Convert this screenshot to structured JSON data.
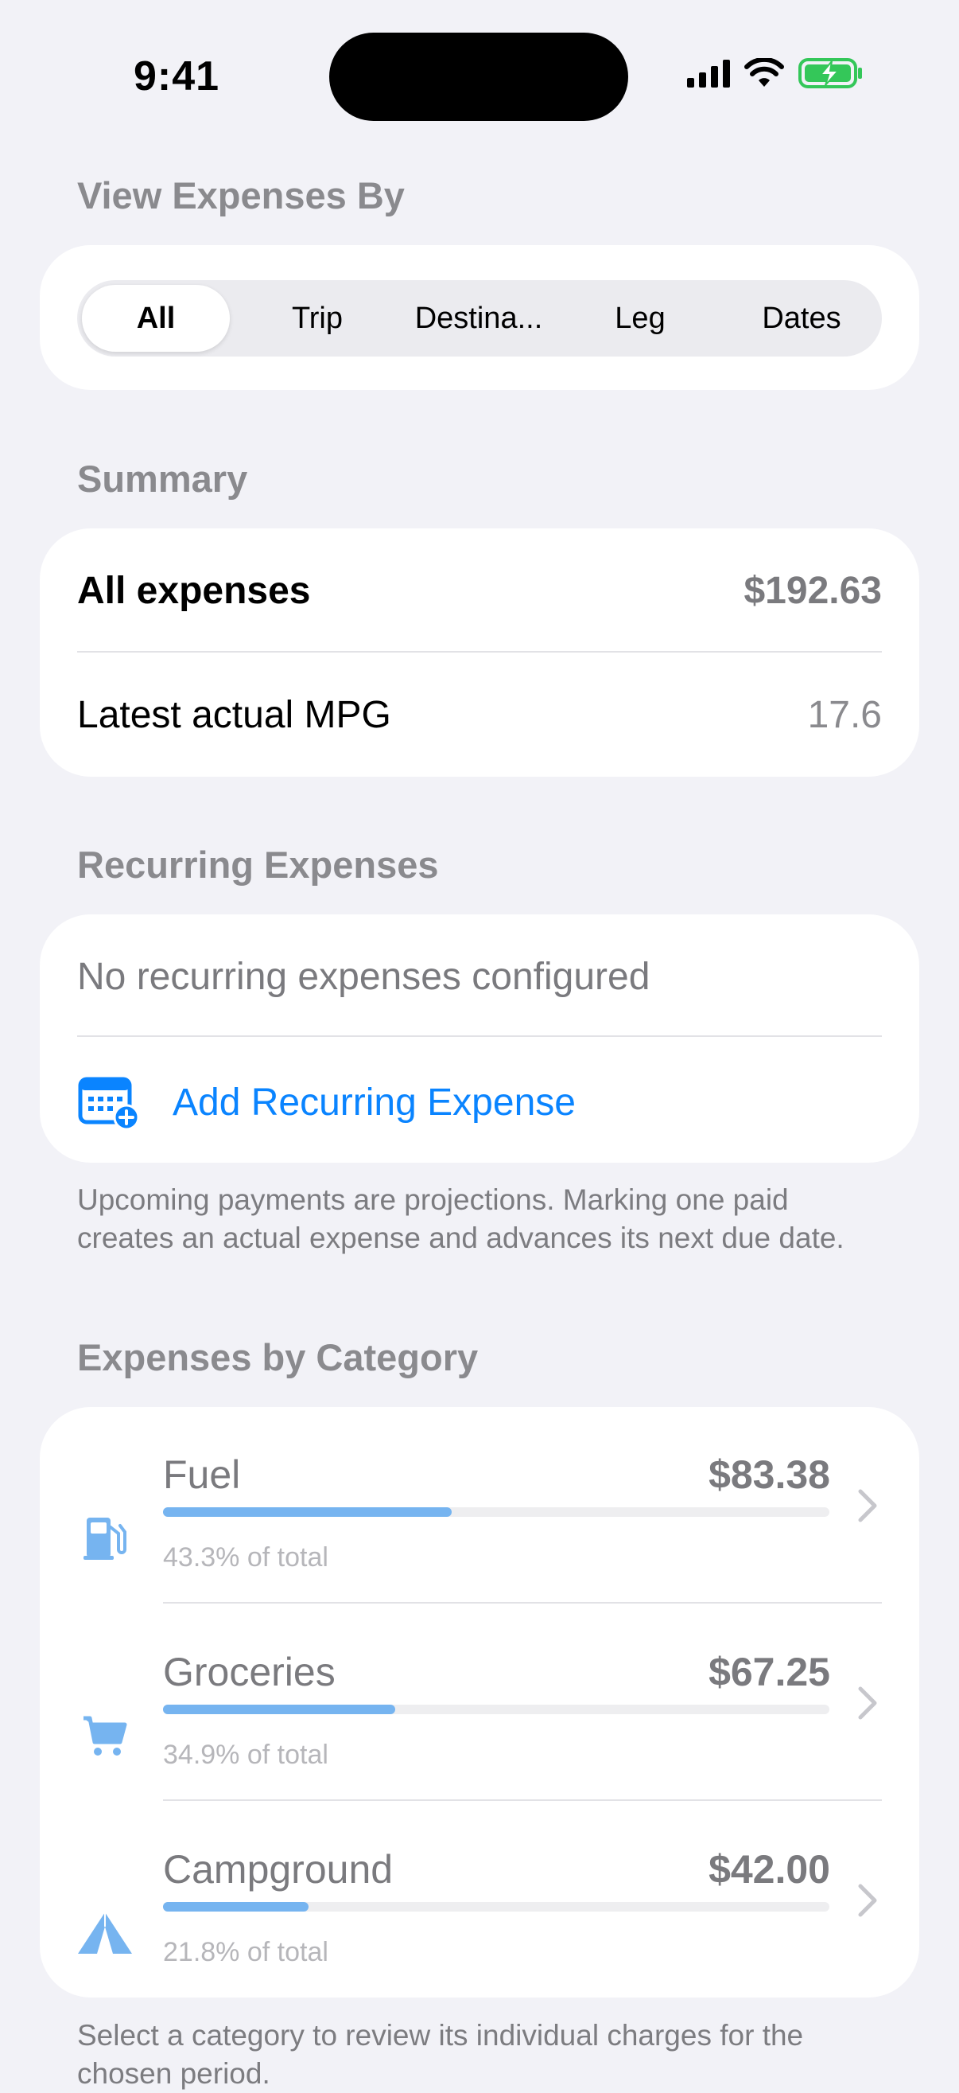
{
  "status_bar": {
    "time": "9:41"
  },
  "view_by": {
    "header": "View Expenses By",
    "segments": [
      "All",
      "Trip",
      "Destina...",
      "Leg",
      "Dates"
    ],
    "selected": "All"
  },
  "summary": {
    "header": "Summary",
    "all_expenses_label": "All expenses",
    "all_expenses_value": "$192.63",
    "mpg_label": "Latest actual MPG",
    "mpg_value": "17.6"
  },
  "recurring": {
    "header": "Recurring Expenses",
    "empty_text": "No recurring expenses configured",
    "add_label": "Add Recurring Expense",
    "footnote": "Upcoming payments are projections. Marking one paid creates an actual expense and advances its next due date."
  },
  "categories": {
    "header": "Expenses by Category",
    "items": [
      {
        "name": "Fuel",
        "amount": "$83.38",
        "percent_text": "43.3% of total",
        "fraction": 0.433,
        "icon": "fuel-pump-icon"
      },
      {
        "name": "Groceries",
        "amount": "$67.25",
        "percent_text": "34.9% of total",
        "fraction": 0.349,
        "icon": "cart-icon"
      },
      {
        "name": "Campground",
        "amount": "$42.00",
        "percent_text": "21.8% of total",
        "fraction": 0.218,
        "icon": "tent-icon"
      }
    ],
    "footnote": "Select a category to review its individual charges for the chosen period."
  },
  "colors": {
    "accent": "#0A84FF",
    "bar": "#76B4F0",
    "battery": "#34C759"
  }
}
